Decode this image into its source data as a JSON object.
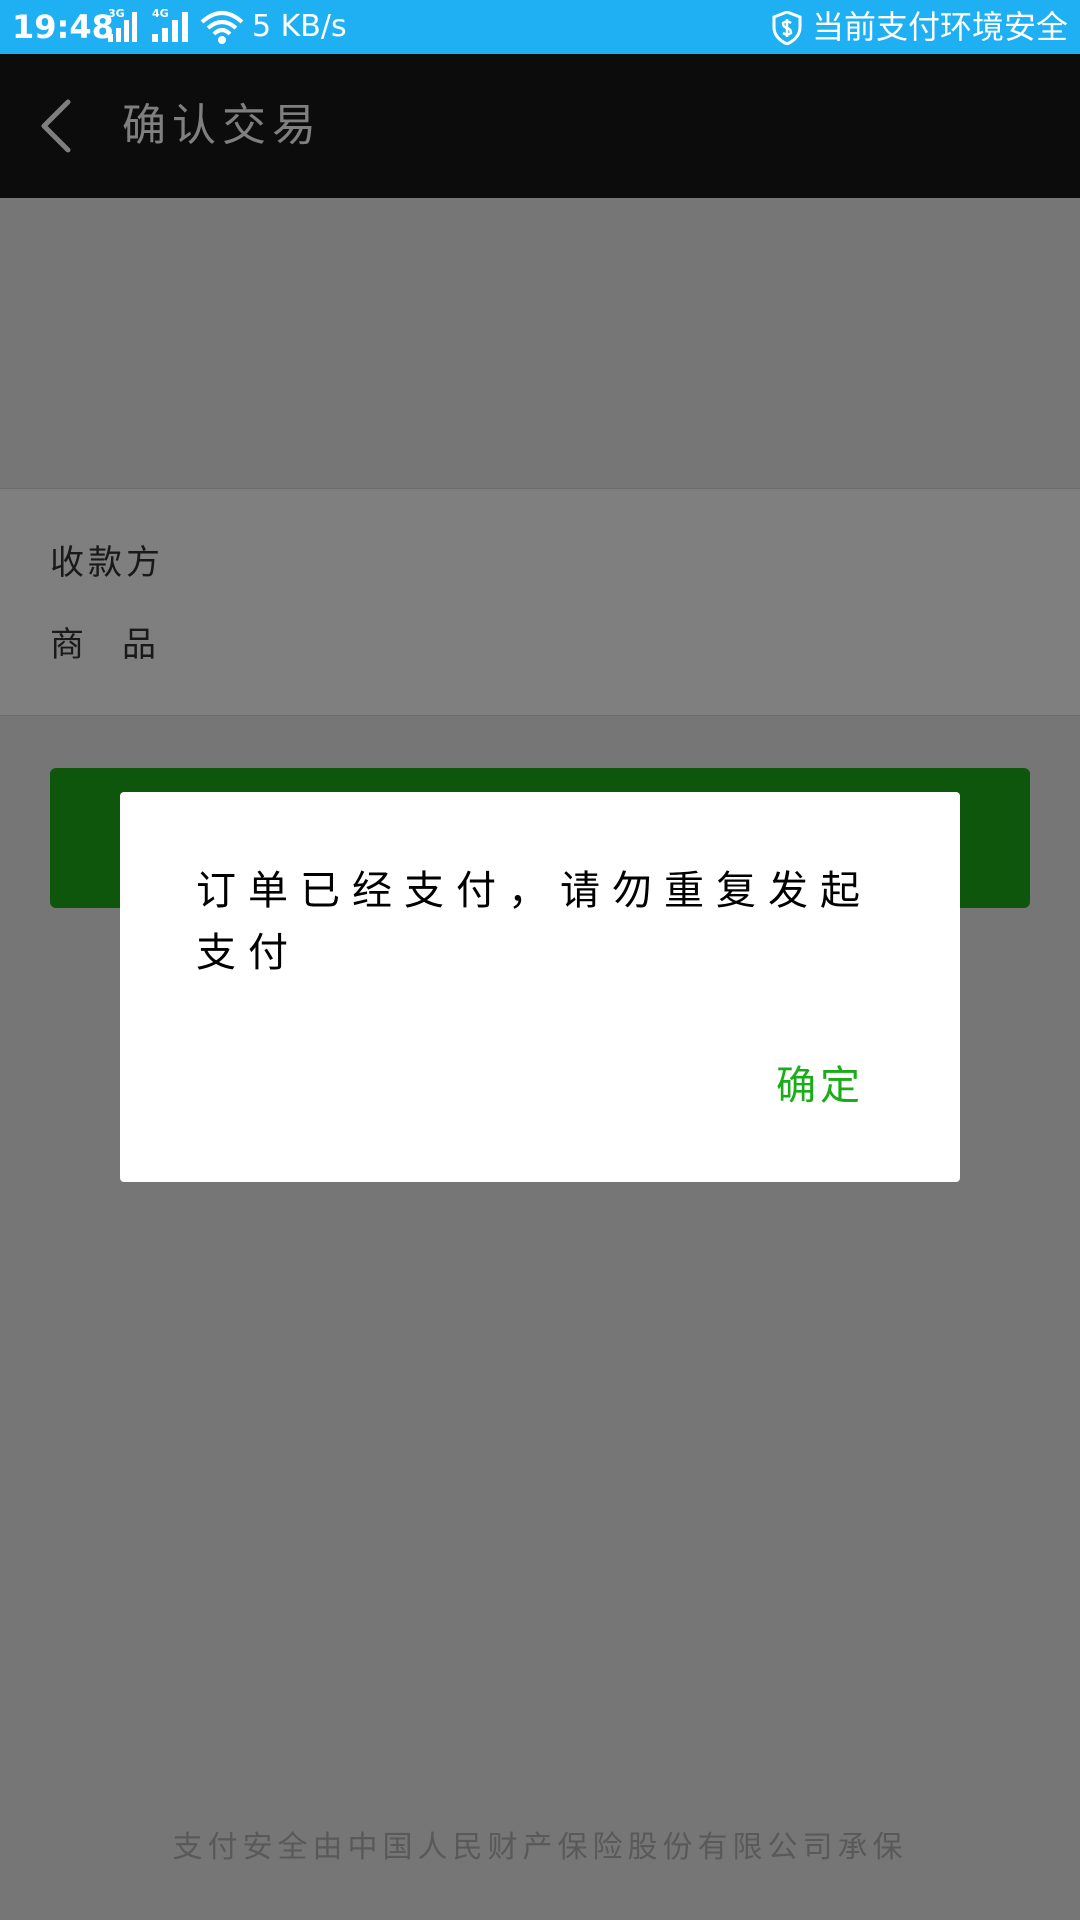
{
  "status_bar": {
    "time": "19:48",
    "sim1_label": "3G",
    "sim2_label": "4G",
    "net_speed": "5 KB/s",
    "security_text": "当前支付环境安全",
    "background": "#1fb0f3"
  },
  "header": {
    "title": "确认交易"
  },
  "info": {
    "payee_label": "收款方",
    "goods_label": "商品"
  },
  "footer": {
    "text": "支付安全由中国人民财产保险股份有限公司承保"
  },
  "dialog": {
    "message": "订单已经支付，请勿重复发起支付",
    "confirm_label": "确定"
  },
  "colors": {
    "accent": "#1aad19",
    "title_bar": "#191919"
  },
  "icons": {
    "back": "chevron-left-icon",
    "signal": "signal-icon",
    "wifi": "wifi-icon",
    "shield": "shield-dollar-icon"
  }
}
